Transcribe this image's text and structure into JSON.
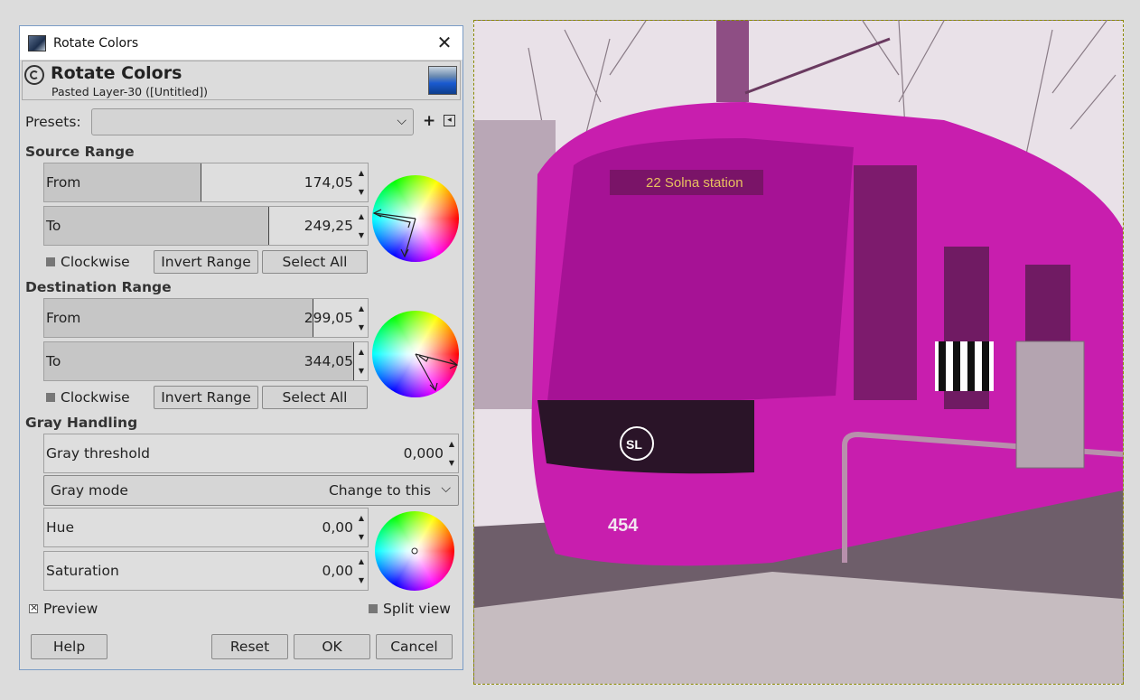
{
  "window": {
    "title": "Rotate Colors"
  },
  "header": {
    "title": "Rotate Colors",
    "subtitle": "Pasted Layer-30 ([Untitled])"
  },
  "presets": {
    "label": "Presets:",
    "value": ""
  },
  "source_range": {
    "heading": "Source Range",
    "from": {
      "label": "From",
      "value": "174,05",
      "fraction": 0.4834
    },
    "to": {
      "label": "To",
      "value": "249,25",
      "fraction": 0.6924
    },
    "clockwise_label": "Clockwise",
    "clockwise_checked": false,
    "invert_label": "Invert Range",
    "select_all_label": "Select All"
  },
  "destination_range": {
    "heading": "Destination Range",
    "from": {
      "label": "From",
      "value": "299,05",
      "fraction": 0.8307
    },
    "to": {
      "label": "To",
      "value": "344,05",
      "fraction": 0.9557
    },
    "clockwise_label": "Clockwise",
    "clockwise_checked": false,
    "invert_label": "Invert Range",
    "select_all_label": "Select All"
  },
  "gray_handling": {
    "heading": "Gray Handling",
    "threshold": {
      "label": "Gray threshold",
      "value": "0,000",
      "fraction": 0
    },
    "mode": {
      "label": "Gray mode",
      "value": "Change to this"
    },
    "hue": {
      "label": "Hue",
      "value": "0,00",
      "fraction": 0
    },
    "saturation": {
      "label": "Saturation",
      "value": "0,00",
      "fraction": 0
    }
  },
  "options": {
    "preview_label": "Preview",
    "preview_checked": true,
    "split_view_label": "Split view",
    "split_view_checked": false
  },
  "buttons": {
    "help": "Help",
    "reset": "Reset",
    "ok": "OK",
    "cancel": "Cancel"
  },
  "canvas": {
    "tram_color": "#d21eb4",
    "tram_number": "454",
    "destination_sign": "22 Solna station",
    "logo_text": "SL"
  }
}
